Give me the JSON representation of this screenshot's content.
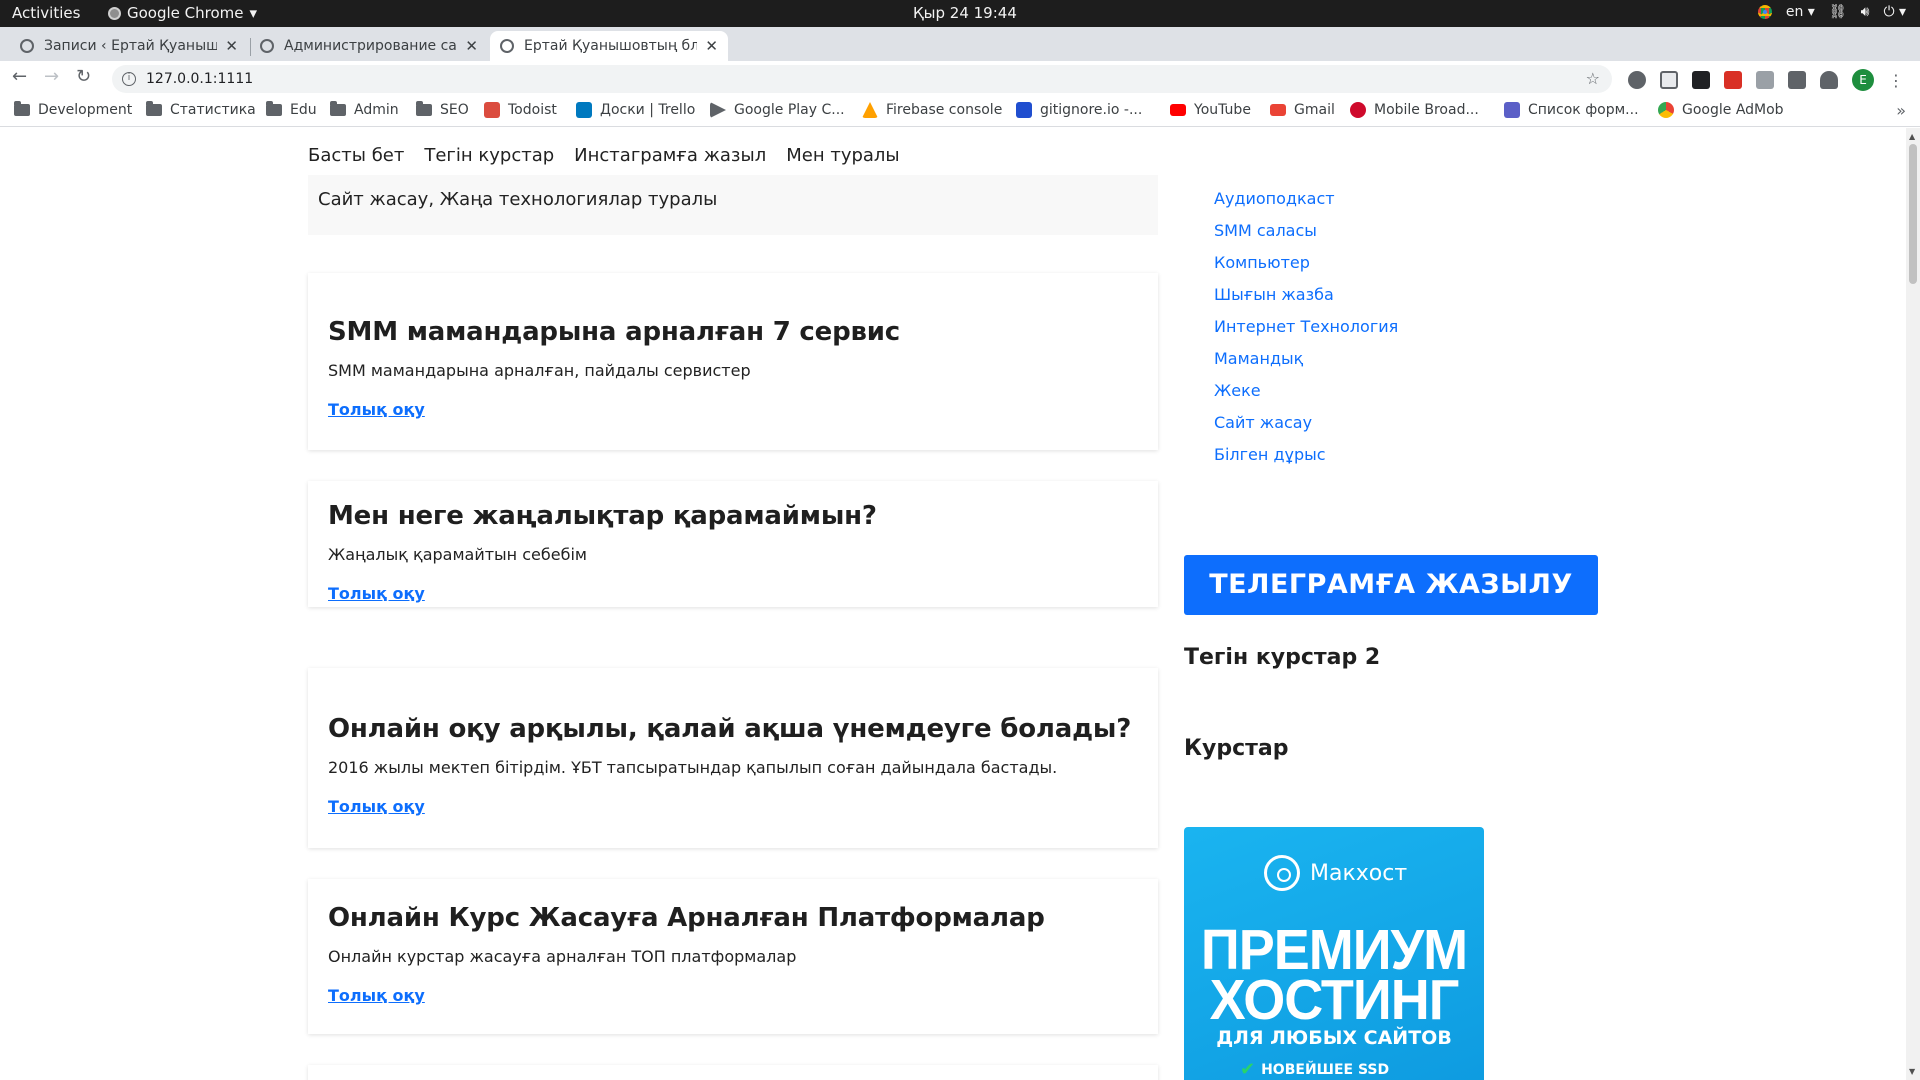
{
  "system_bar": {
    "activities": "Activities",
    "app_name": "Google Chrome",
    "clock": "Қыр 24  19:44",
    "language": "en"
  },
  "tabs": [
    {
      "title": "Записи ‹ Ертай Қуанышовтың блогы",
      "active": false
    },
    {
      "title": "Администрирование сайта",
      "active": false
    },
    {
      "title": "Ертай Қуанышовтың блогы",
      "active": true
    }
  ],
  "address_bar": {
    "url": "127.0.0.1:1111"
  },
  "bookmarks": [
    {
      "label": "Development",
      "icon": "folder-icon"
    },
    {
      "label": "Статистика",
      "icon": "folder-icon"
    },
    {
      "label": "Edu",
      "icon": "folder-icon"
    },
    {
      "label": "Admin",
      "icon": "folder-icon"
    },
    {
      "label": "SEO",
      "icon": "folder-icon"
    },
    {
      "label": "Todoist",
      "icon": "todoist-icon"
    },
    {
      "label": "Доски | Trello",
      "icon": "trello-icon"
    },
    {
      "label": "Google Play C...",
      "icon": "google-play-icon"
    },
    {
      "label": "Firebase console",
      "icon": "firebase-icon"
    },
    {
      "label": "gitignore.io -...",
      "icon": "gitignore-icon"
    },
    {
      "label": "YouTube",
      "icon": "youtube-icon"
    },
    {
      "label": "Gmail",
      "icon": "gmail-icon"
    },
    {
      "label": "Mobile Broad...",
      "icon": "huawei-icon"
    },
    {
      "label": "Список форм...",
      "icon": "forms-icon"
    },
    {
      "label": "Google AdMob",
      "icon": "admob-icon"
    }
  ],
  "site": {
    "nav": [
      "Басты бет",
      "Тегін курстар",
      "Инстаграмға жазыл",
      "Мен туралы"
    ],
    "tagline": "Сайт жасау, Жаңа технологиялар туралы",
    "read_more": "Толық оқу",
    "posts": [
      {
        "title": "SMM мамандарына арналған 7 сервис",
        "excerpt": "SMM мамандарына арналған, пайдалы сервистер"
      },
      {
        "title": "Мен неге жаңалықтар қарамаймын?",
        "excerpt": "Жаңалық қарамайтын себебім"
      },
      {
        "title": "Онлайн оқу арқылы, қалай ақша үнемдеуге болады?",
        "excerpt": "2016 жылы мектеп бітірдім. ҰБТ тапсыратындар қапылып соған дайындала бастады."
      },
      {
        "title": "Онлайн Курс Жасауға Арналған Платформалар",
        "excerpt": "Онлайн курстар жасауға арналған ТОП платформалар"
      }
    ],
    "categories": [
      "Аудиоподкаст",
      "SMM саласы",
      "Компьютер",
      "Шығын жазба",
      "Интернет Технология",
      "Мамандық",
      "Жеке",
      "Сайт жасау",
      "Білген дұрыс"
    ],
    "telegram_button": "ТЕЛЕГРАМҒА ЖАЗЫЛУ",
    "widget1_title": "Тегін курстар 2",
    "widget2_title": "Курстар",
    "ad": {
      "brand": "Макхост",
      "line1": "ПРЕМИУМ",
      "line2": "ХОСТИНГ",
      "line3": "ДЛЯ ЛЮБЫХ САЙТОВ",
      "feature": "НОВЕЙШЕЕ SSD"
    }
  },
  "colors": {
    "link": "#0d6efd",
    "telegram_button": "#0d6efd",
    "ad_background": "#1ab4f0"
  }
}
